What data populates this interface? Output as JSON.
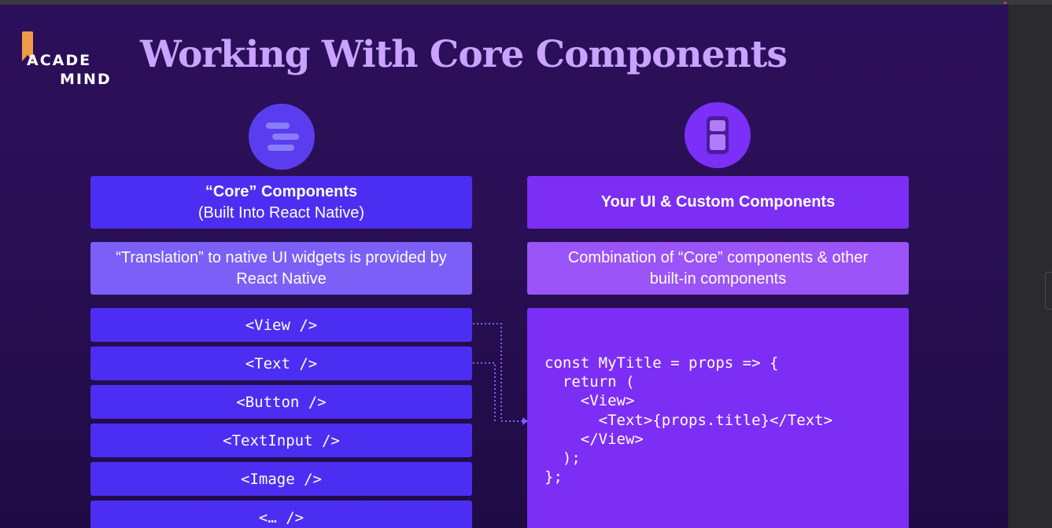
{
  "title": "Working With Core Components",
  "logo": {
    "line1": "ACADE",
    "line2": "MIND"
  },
  "left": {
    "header_bold": "“Core” Components",
    "header_sub": "(Built Into React Native)",
    "description": "“Translation” to native UI widgets is provided by React Native",
    "components": [
      "<View />",
      "<Text />",
      "<Button />",
      "<TextInput />",
      "<Image />",
      "<… />"
    ]
  },
  "right": {
    "header": "Your UI & Custom Components",
    "description": "Combination of “Core” components & other built-in components",
    "code": "const MyTitle = props => {\n  return (\n    <View>\n      <Text>{props.title}</Text>\n    </View>\n  );\n};"
  },
  "icons": {
    "left": "list-lines-icon",
    "right": "stacked-blocks-icon"
  },
  "colors": {
    "title": "#c9a3ff",
    "left_accent": "#4c2ef2",
    "right_accent": "#7d2ef5",
    "logo_flag": "#f29a4a"
  }
}
